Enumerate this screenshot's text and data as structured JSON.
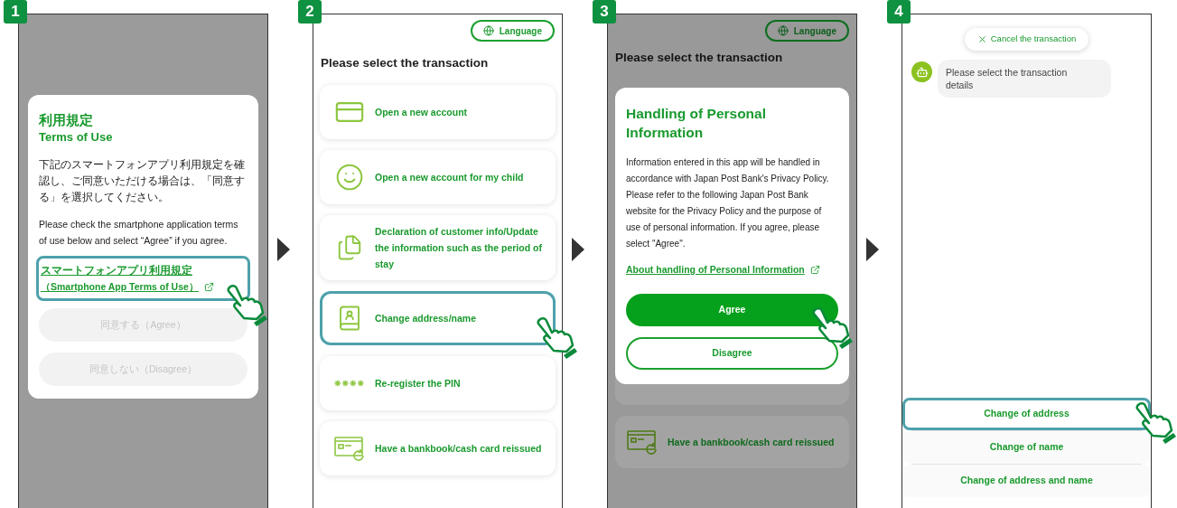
{
  "steps": [
    {
      "kind": "terms",
      "badge": "1",
      "title_ja": "利用規定",
      "title_en": "Terms of Use",
      "body": [
        "下記のスマートフォンアプリ利用規定を確認し、ご同意いただける場合は、「同意する」を選択してください。",
        "Please check the smartphone application terms of use below and select “Agree” if you agree."
      ],
      "link": {
        "lines": [
          "スマートフォンアプリ利用規定",
          "（Smartphone App Terms of Use）"
        ],
        "highlighted": true
      },
      "buttons": [
        {
          "label": "同意する（Agree）",
          "disabled": true
        },
        {
          "label": "同意しない（Disagree）",
          "disabled": true
        }
      ]
    },
    {
      "kind": "menu",
      "badge": "2",
      "language_button": "Language",
      "title": "Please select the transaction",
      "items": [
        {
          "label": "Open a new account",
          "selected": false
        },
        {
          "label": "Open a new account for my child",
          "selected": false
        },
        {
          "label": "Declaration of customer info/Update the information such as the period of stay",
          "selected": false
        },
        {
          "label": "Change address/name",
          "selected": true
        },
        {
          "label": "Re-register the PIN",
          "selected": false
        },
        {
          "label": "Have a bankbook/cash card reissued",
          "selected": false
        }
      ]
    },
    {
      "kind": "privacy",
      "badge": "3",
      "language_button": "Language",
      "title": "Please select the transaction",
      "background_item": "Have a bankbook/cash card reissued",
      "modal": {
        "title": "Handling of Personal Information",
        "body": [
          "Information entered in this app will be handled in accordance with Japan Post Bank's Privacy Policy.",
          "Please refer to the following Japan Post Bank website for the Privacy Policy and the purpose of use of personal information. If you agree, please select \"Agree\"."
        ],
        "link": "About handling of Personal Information",
        "buttons": [
          {
            "label": "Agree",
            "kind": "primary",
            "pressed": true
          },
          {
            "label": "Disagree",
            "kind": "outline",
            "pressed": false
          }
        ]
      }
    },
    {
      "kind": "chat",
      "badge": "4",
      "cancel_button": "Cancel the transaction",
      "message": "Please select the transaction details",
      "options": [
        {
          "label": "Change of address",
          "selected": true
        },
        {
          "label": "Change of name",
          "selected": false
        },
        {
          "label": "Change of address and name",
          "selected": false
        }
      ]
    }
  ]
}
